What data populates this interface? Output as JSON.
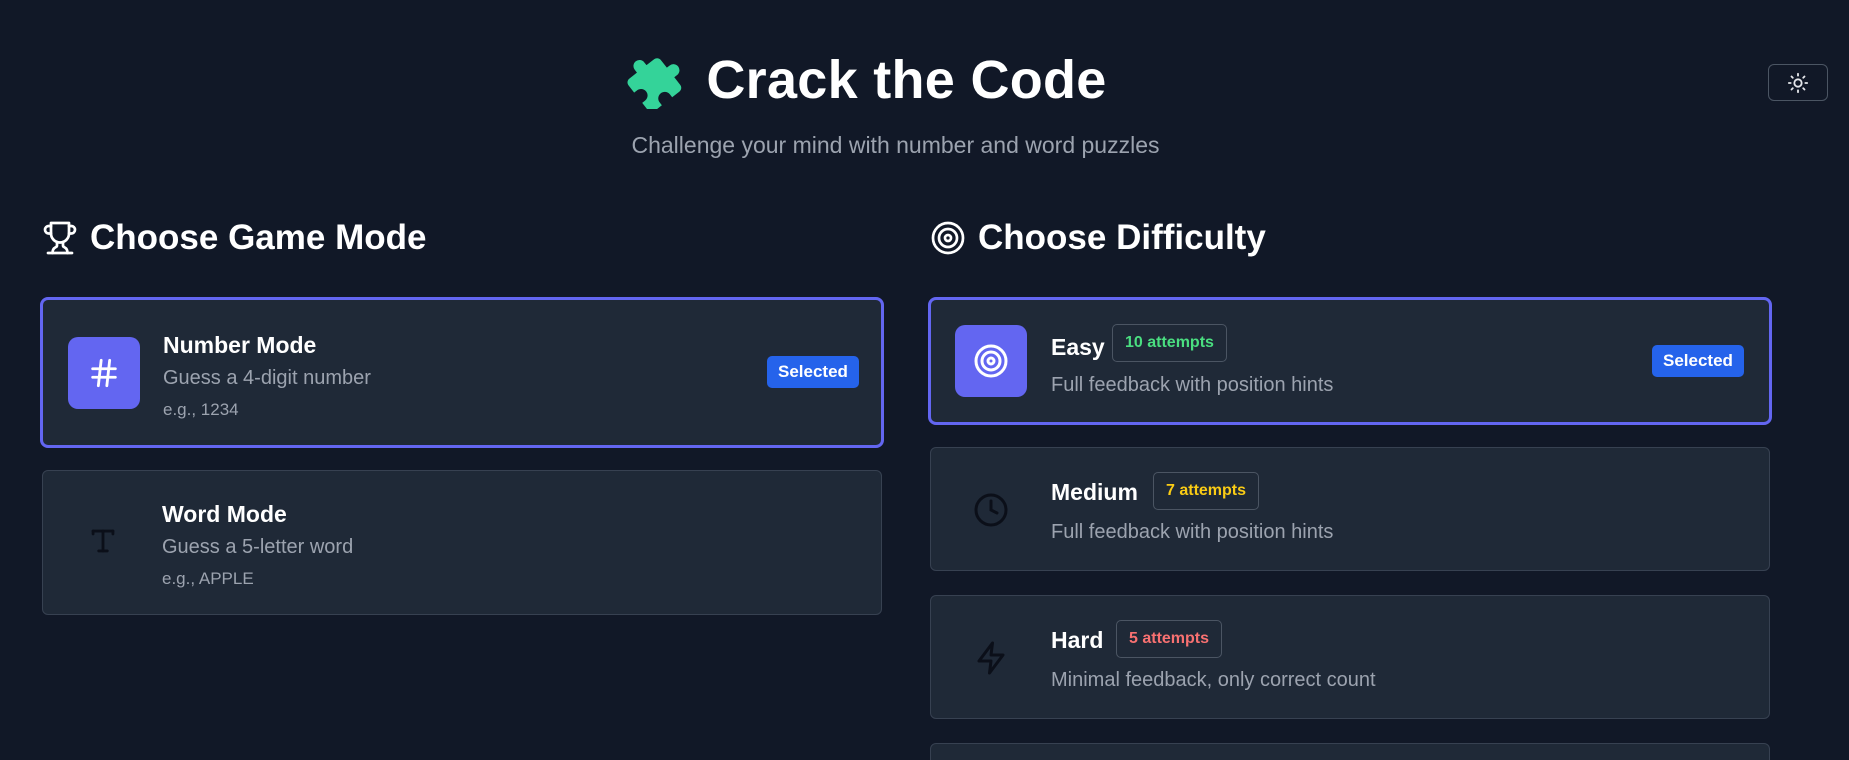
{
  "header": {
    "title": "Crack the Code",
    "subtitle": "Challenge your mind with number and word puzzles",
    "title_icon": "puzzle-icon",
    "theme_toggle_icon": "sun-icon"
  },
  "game_mode": {
    "heading": "Choose Game Mode",
    "heading_icon": "trophy-icon",
    "options": [
      {
        "title": "Number Mode",
        "description": "Guess a 4-digit number",
        "example": "e.g., 1234",
        "icon": "hash-icon",
        "selected": true,
        "badge": "Selected"
      },
      {
        "title": "Word Mode",
        "description": "Guess a 5-letter word",
        "example": "e.g., APPLE",
        "icon": "type-icon",
        "selected": false
      }
    ]
  },
  "difficulty": {
    "heading": "Choose Difficulty",
    "heading_icon": "target-icon",
    "options": [
      {
        "title": "Easy",
        "attempts": "10 attempts",
        "attempts_color": "#4ade80",
        "description": "Full feedback with position hints",
        "icon": "target-icon",
        "selected": true,
        "badge": "Selected"
      },
      {
        "title": "Medium",
        "attempts": "7 attempts",
        "attempts_color": "#facc15",
        "description": "Full feedback with position hints",
        "icon": "clock-icon",
        "selected": false
      },
      {
        "title": "Hard",
        "attempts": "5 attempts",
        "attempts_color": "#f87171",
        "description": "Minimal feedback, only correct count",
        "icon": "lightning-icon",
        "selected": false
      }
    ]
  },
  "colors": {
    "background": "#111827",
    "card": "#1f2937",
    "accent": "#6366f1",
    "badge": "#2563eb",
    "puzzle": "#34d399"
  }
}
